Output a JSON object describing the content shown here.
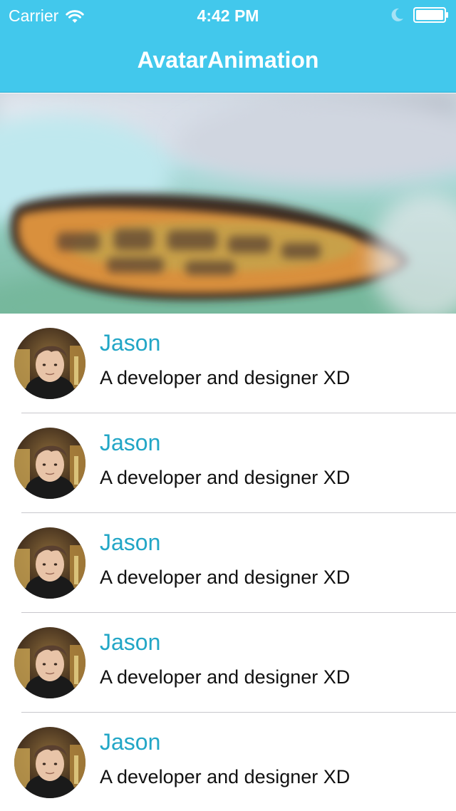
{
  "status_bar": {
    "carrier": "Carrier",
    "time": "4:42 PM",
    "icons": [
      "wifi-icon",
      "moon-icon",
      "battery-icon"
    ]
  },
  "nav": {
    "title": "AvatarAnimation"
  },
  "list": {
    "items": [
      {
        "name": "Jason",
        "description": "A developer and designer XD"
      },
      {
        "name": "Jason",
        "description": "A developer and designer XD"
      },
      {
        "name": "Jason",
        "description": "A developer and designer XD"
      },
      {
        "name": "Jason",
        "description": "A developer and designer XD"
      },
      {
        "name": "Jason",
        "description": "A developer and designer XD"
      }
    ]
  },
  "colors": {
    "nav_background": "#42c8ec",
    "name_text": "#22a6c6",
    "description_text": "#111111",
    "separator": "#c8c7cc"
  }
}
